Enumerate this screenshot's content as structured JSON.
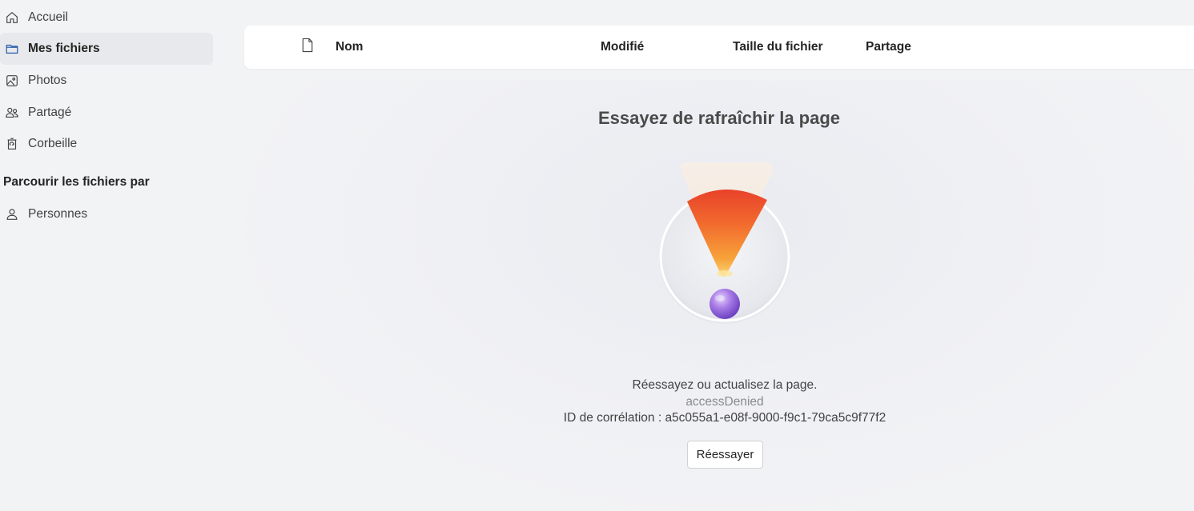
{
  "sidebar": {
    "items": [
      {
        "label": "Accueil",
        "icon": "home-icon"
      },
      {
        "label": "Mes fichiers",
        "icon": "folder-icon",
        "active": true
      },
      {
        "label": "Photos",
        "icon": "photo-icon"
      },
      {
        "label": "Partagé",
        "icon": "people-icon"
      },
      {
        "label": "Corbeille",
        "icon": "recycle-bin-icon"
      }
    ],
    "browse_title": "Parcourir les fichiers par",
    "browse_items": [
      {
        "label": "Personnes",
        "icon": "person-icon"
      }
    ]
  },
  "header": {
    "file_icon": "file-icon",
    "columns": {
      "name": "Nom",
      "modified": "Modifié",
      "size": "Taille du fichier",
      "sharing": "Partage"
    }
  },
  "error": {
    "title": "Essayez de rafraîchir la page",
    "illustration_icon": "exclamation-illustration-icon",
    "message": "Réessayez ou actualisez la page.",
    "code": "accessDenied",
    "correlation": "ID de corrélation : a5c055a1-e08f-9000-f9c1-79ca5c9f77f2",
    "retry_label": "Réessayer"
  },
  "colors": {
    "background": "#f2f3f5",
    "active_nav": "#e8e9ec",
    "accent_orange": "#f26b2e",
    "accent_purple": "#9b6be0"
  }
}
